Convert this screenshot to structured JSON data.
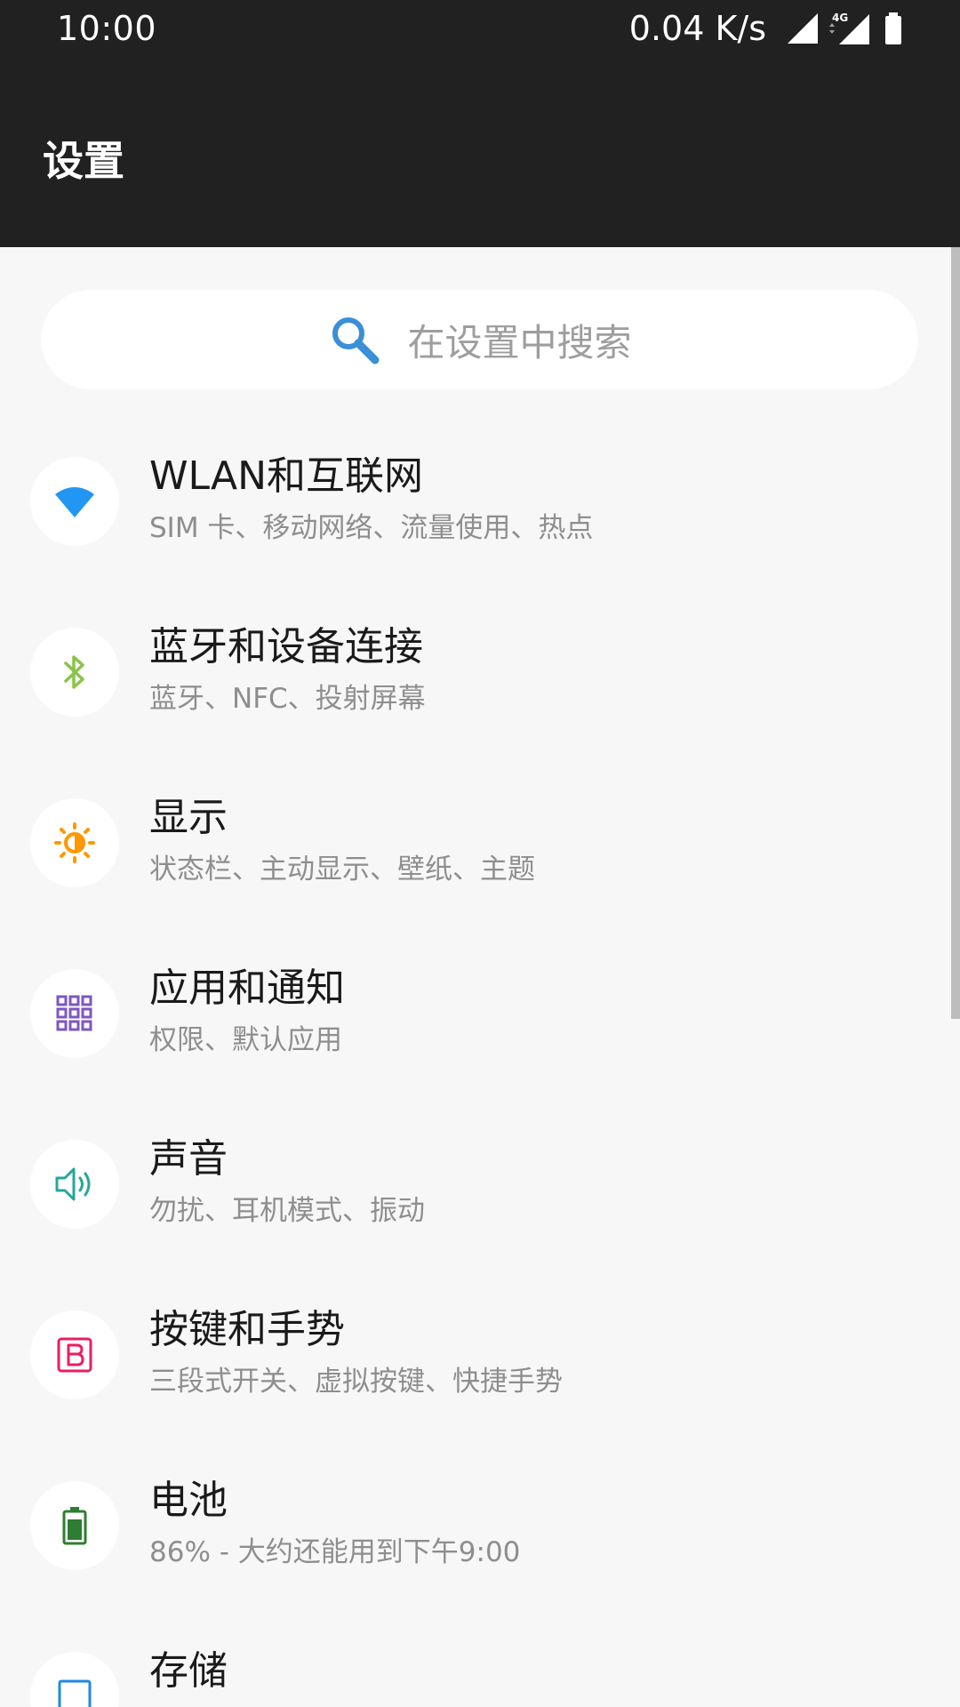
{
  "status_bar": {
    "time": "10:00",
    "net_speed": "0.04 K/s",
    "network_type": "4G",
    "icons": [
      "signal-icon",
      "signal-4g-icon",
      "battery-icon"
    ]
  },
  "app_bar": {
    "title": "设置"
  },
  "search": {
    "placeholder": "在设置中搜索",
    "icon": "search-icon"
  },
  "colors": {
    "bar_background": "#212121",
    "page_background": "#f7f7f7",
    "wlan": "#2196f3",
    "bluetooth": "#8bc34a",
    "display": "#ff9800",
    "apps": "#7e57c2",
    "sound": "#26a69a",
    "buttons": "#e91e63",
    "battery": "#2e7d32",
    "storage": "#1e88e5"
  },
  "settings": [
    {
      "title": "WLAN和互联网",
      "subtitle": "SIM 卡、移动网络、流量使用、热点",
      "icon": "wifi-icon"
    },
    {
      "title": "蓝牙和设备连接",
      "subtitle": "蓝牙、NFC、投射屏幕",
      "icon": "bluetooth-icon"
    },
    {
      "title": "显示",
      "subtitle": "状态栏、主动显示、壁纸、主题",
      "icon": "brightness-icon"
    },
    {
      "title": "应用和通知",
      "subtitle": "权限、默认应用",
      "icon": "apps-grid-icon"
    },
    {
      "title": "声音",
      "subtitle": "勿扰、耳机模式、振动",
      "icon": "speaker-icon"
    },
    {
      "title": "按键和手势",
      "subtitle": "三段式开关、虚拟按键、快捷手势",
      "icon": "buttons-icon"
    },
    {
      "title": "电池",
      "subtitle": "86% - 大约还能用到下午9:00",
      "icon": "battery-icon"
    },
    {
      "title": "存储",
      "subtitle": "",
      "icon": "storage-icon"
    }
  ]
}
